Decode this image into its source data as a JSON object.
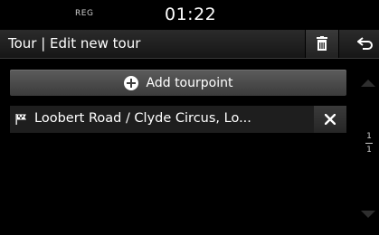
{
  "status": {
    "reg_label": "REG",
    "time": "01:22"
  },
  "header": {
    "title": "Tour | Edit new tour",
    "delete_icon": "trash-icon",
    "back_icon": "back-icon"
  },
  "main": {
    "add_button_label": "Add tourpoint",
    "tourpoints": [
      {
        "label": "Loobert Road / Clyde Circus, Lo..."
      }
    ]
  },
  "pager": {
    "current": "1",
    "total": "1"
  },
  "colors": {
    "background": "#000000",
    "button": "#4a4a4a",
    "text": "#ffffff"
  }
}
